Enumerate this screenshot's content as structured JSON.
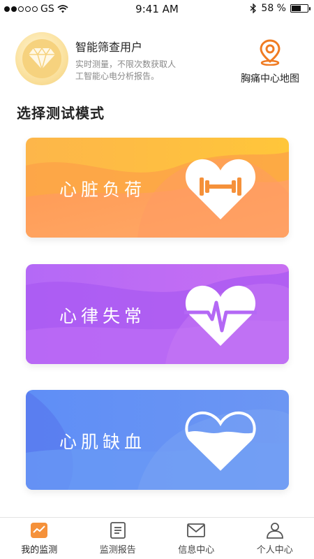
{
  "status_bar": {
    "carrier": "GS",
    "time": "9:41 AM",
    "battery": "58 %",
    "battery_level": 0.58
  },
  "header": {
    "user_name": "智能筛查用户",
    "user_desc": "实时测量，不限次数获取人工智能心电分析报告。",
    "map_label": "胸痛中心地图"
  },
  "section_title": "选择测试模式",
  "cards": [
    {
      "label": "心脏负荷",
      "icon": "dumbbell-heart-icon"
    },
    {
      "label": "心律失常",
      "icon": "pulse-heart-icon"
    },
    {
      "label": "心肌缺血",
      "icon": "half-heart-icon"
    }
  ],
  "tabbar": {
    "items": [
      {
        "label": "我的监测",
        "icon": "monitor-chart-icon",
        "active": true
      },
      {
        "label": "监测报告",
        "icon": "report-icon",
        "active": false
      },
      {
        "label": "信息中心",
        "icon": "mail-icon",
        "active": false
      },
      {
        "label": "个人中心",
        "icon": "person-icon",
        "active": false
      }
    ]
  },
  "colors": {
    "accent_orange": "#f07b22",
    "card1": "#fbb03b",
    "card2": "#b264f0",
    "card3": "#5b8cf5"
  }
}
